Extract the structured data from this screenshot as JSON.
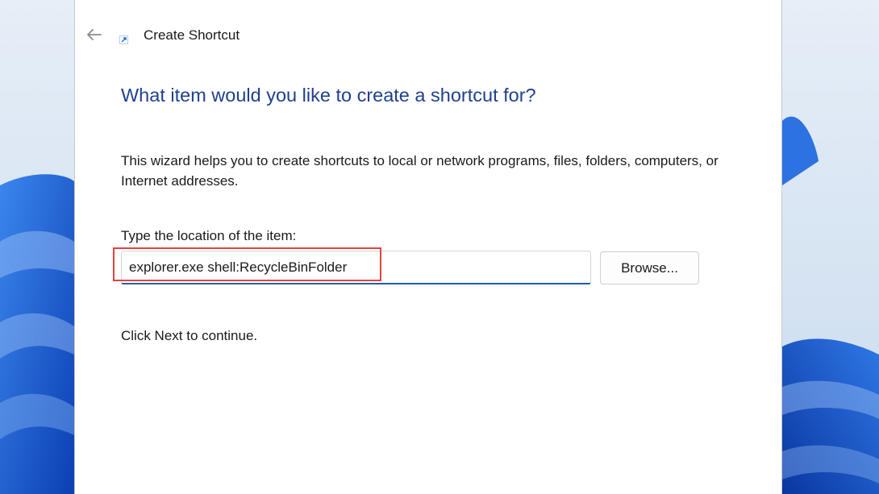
{
  "window": {
    "title": "Create Shortcut",
    "icons": {
      "back": "back-arrow-icon",
      "app": "shortcut-arrow-icon",
      "close": "close-icon"
    }
  },
  "wizard": {
    "heading": "What item would you like to create a shortcut for?",
    "description": "This wizard helps you to create shortcuts to local or network programs, files, folders, computers, or Internet addresses.",
    "location_label": "Type the location of the item:",
    "location_value": "explorer.exe shell:RecycleBinFolder",
    "browse_label": "Browse...",
    "footer_note": "Click Next to continue."
  },
  "colors": {
    "heading": "#1f3f8f",
    "input_underline": "#1f5faa",
    "highlight_annotation": "#e0443e",
    "wallpaper_blue": "#1d5fd6"
  }
}
